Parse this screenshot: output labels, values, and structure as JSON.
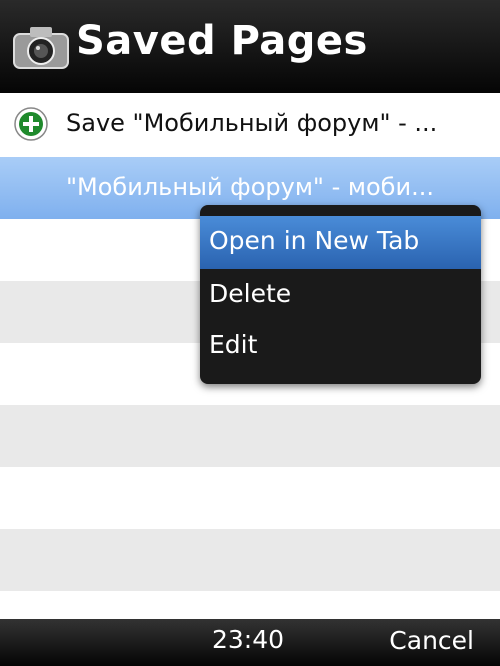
{
  "header": {
    "title": "Saved Pages"
  },
  "list": {
    "items": [
      {
        "label": "Save \"Мобильный форум\" - ..."
      },
      {
        "label": "\"Мобильный форум\" - моби..."
      }
    ]
  },
  "context_menu": {
    "items": [
      {
        "label": "Open in New Tab"
      },
      {
        "label": "Delete"
      },
      {
        "label": "Edit"
      }
    ]
  },
  "footer": {
    "time": "23:40",
    "cancel_label": "Cancel"
  }
}
